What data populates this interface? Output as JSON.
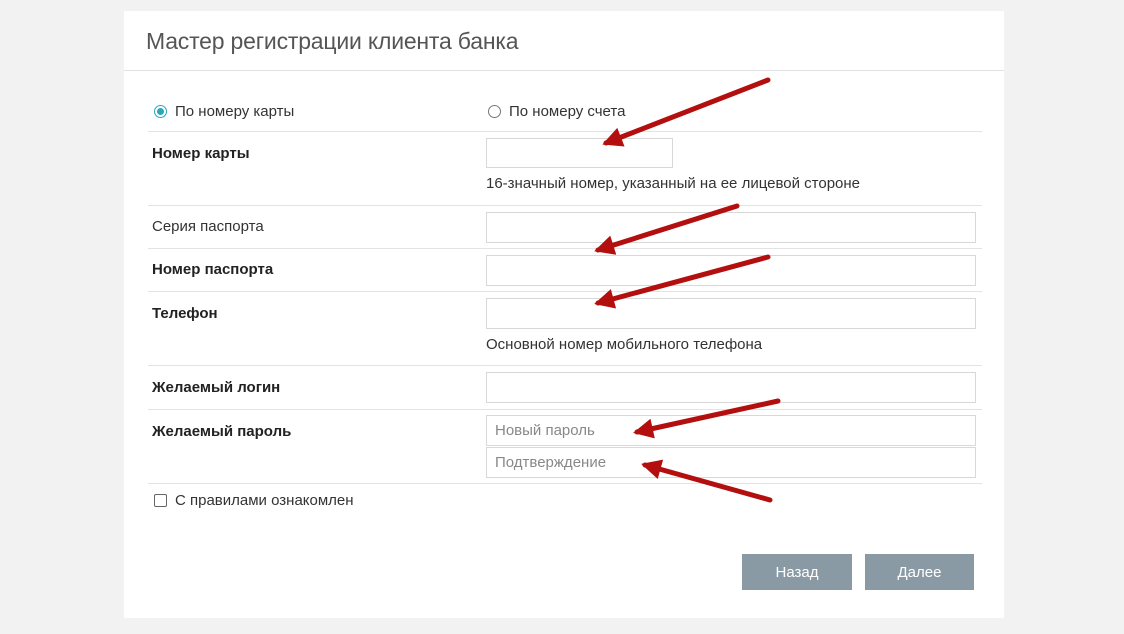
{
  "header": {
    "title": "Мастер регистрации клиента банка"
  },
  "mode": {
    "by_card_label": "По номеру карты",
    "by_account_label": "По номеру счета",
    "selected": "by_card"
  },
  "fields": {
    "card_number": {
      "label": "Номер карты",
      "value": "",
      "help": "16-значный номер, указанный на ее лицевой стороне"
    },
    "passport_series": {
      "label": "Серия паспорта",
      "value": ""
    },
    "passport_number": {
      "label": "Номер паспорта",
      "value": ""
    },
    "phone": {
      "label": "Телефон",
      "value": "",
      "help": "Основной номер мобильного телефона"
    },
    "login": {
      "label": "Желаемый логин",
      "value": ""
    },
    "password": {
      "label": "Желаемый пароль",
      "new_placeholder": "Новый пароль",
      "confirm_placeholder": "Подтверждение"
    }
  },
  "agreement": {
    "label": "С правилами ознакомлен",
    "checked": false
  },
  "buttons": {
    "back_label": "Назад",
    "next_label": "Далее"
  },
  "colors": {
    "arrow": "#b30f0f",
    "button": "#8a9aa4",
    "radio_accent": "#2aa8b8"
  }
}
